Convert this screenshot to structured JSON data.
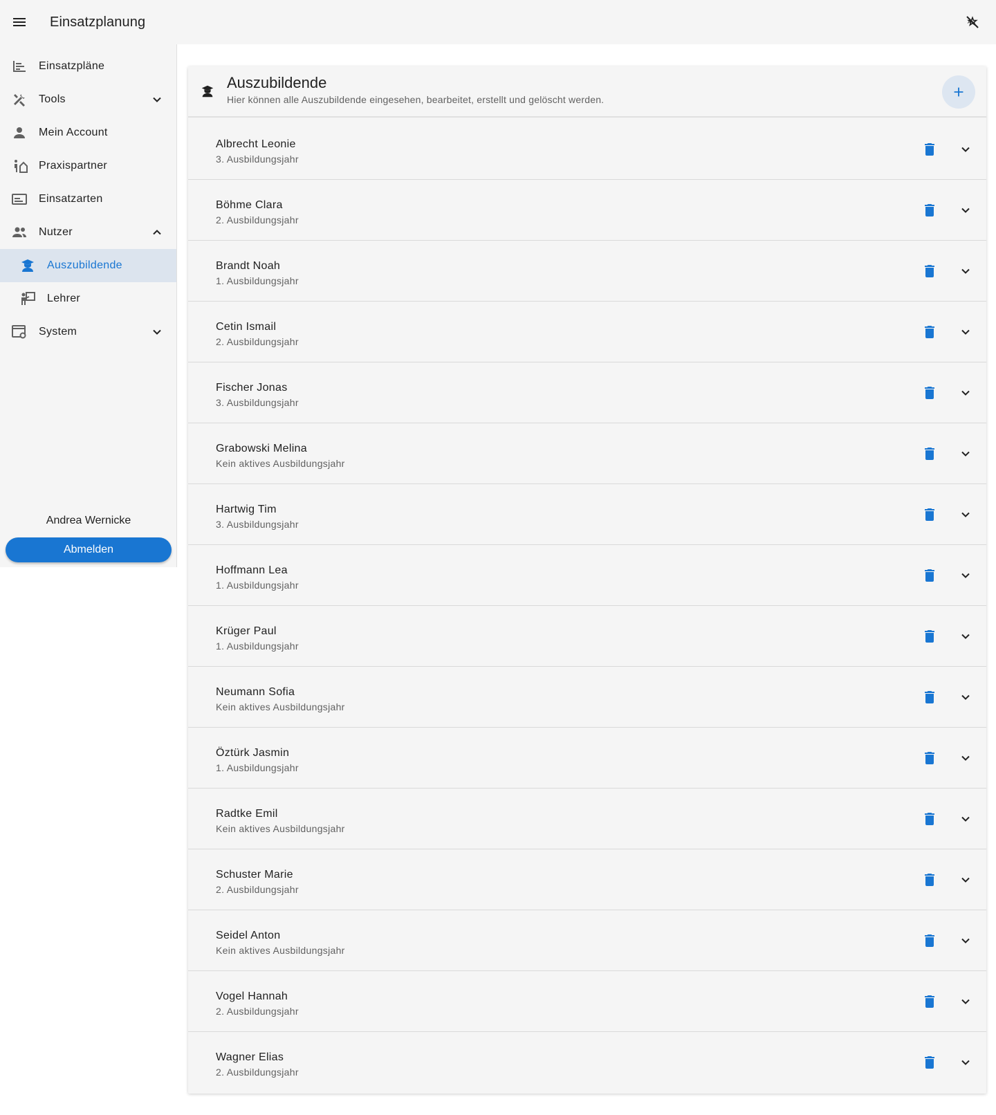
{
  "appbar": {
    "title": "Einsatzplanung",
    "menu_icon": "menu-icon",
    "theme_icon": "brightness-auto-off-icon"
  },
  "sidebar": {
    "items": [
      {
        "label": "Einsatzpläne",
        "icon": "timeline-list-icon"
      },
      {
        "label": "Tools",
        "icon": "tools-icon",
        "expandable": true,
        "expanded": false
      },
      {
        "label": "Mein Account",
        "icon": "person-icon"
      },
      {
        "label": "Praxispartner",
        "icon": "partner-icon"
      },
      {
        "label": "Einsatzarten",
        "icon": "card-icon"
      },
      {
        "label": "Nutzer",
        "icon": "group-icon",
        "expandable": true,
        "expanded": true
      },
      {
        "label": "Auszubildende",
        "icon": "student-icon",
        "sub": true,
        "active": true
      },
      {
        "label": "Lehrer",
        "icon": "teacher-icon",
        "sub": true
      },
      {
        "label": "System",
        "icon": "system-settings-icon",
        "expandable": true,
        "expanded": false
      }
    ],
    "user_name": "Andrea Wernicke",
    "logout_label": "Abmelden"
  },
  "colors": {
    "accent": "#1976d2",
    "active_bg": "#dce4ee",
    "surface": "#f5f5f5"
  },
  "card": {
    "title": "Auszubildende",
    "subtitle": "Hier können alle Auszubildende eingesehen, bearbeitet, erstellt und gelöscht werden.",
    "rows": [
      {
        "name": "Albrecht Leonie",
        "year": "3. Ausbildungsjahr"
      },
      {
        "name": "Böhme Clara",
        "year": "2. Ausbildungsjahr"
      },
      {
        "name": "Brandt Noah",
        "year": "1. Ausbildungsjahr"
      },
      {
        "name": "Cetin Ismail",
        "year": "2. Ausbildungsjahr"
      },
      {
        "name": "Fischer Jonas",
        "year": "3. Ausbildungsjahr"
      },
      {
        "name": "Grabowski Melina",
        "year": "Kein aktives Ausbildungsjahr"
      },
      {
        "name": "Hartwig Tim",
        "year": "3. Ausbildungsjahr"
      },
      {
        "name": "Hoffmann Lea",
        "year": "1. Ausbildungsjahr"
      },
      {
        "name": "Krüger Paul",
        "year": "1. Ausbildungsjahr"
      },
      {
        "name": "Neumann Sofia",
        "year": "Kein aktives Ausbildungsjahr"
      },
      {
        "name": "Öztürk Jasmin",
        "year": "1. Ausbildungsjahr"
      },
      {
        "name": "Radtke Emil",
        "year": "Kein aktives Ausbildungsjahr"
      },
      {
        "name": "Schuster Marie",
        "year": "2. Ausbildungsjahr"
      },
      {
        "name": "Seidel Anton",
        "year": "Kein aktives Ausbildungsjahr"
      },
      {
        "name": "Vogel Hannah",
        "year": "2. Ausbildungsjahr"
      },
      {
        "name": "Wagner Elias",
        "year": "2. Ausbildungsjahr"
      }
    ]
  }
}
